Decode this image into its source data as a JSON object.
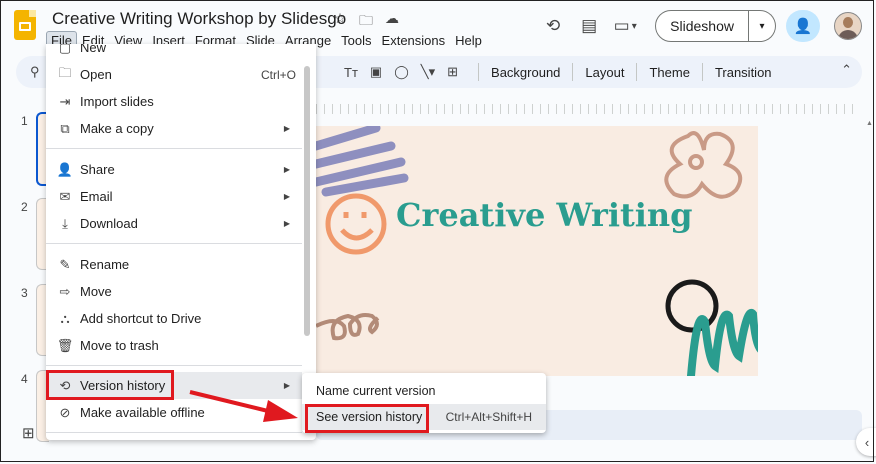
{
  "app": {
    "title": "Creative Writing Workshop by Slidesgo",
    "menus": [
      "File",
      "Edit",
      "View",
      "Insert",
      "Format",
      "Slide",
      "Arrange",
      "Tools",
      "Extensions",
      "Help"
    ],
    "active_menu": "File",
    "slideshow_label": "Slideshow"
  },
  "toolbar": {
    "buttons": [
      "Background",
      "Layout",
      "Theme",
      "Transition"
    ]
  },
  "filmstrip": {
    "slide_numbers": [
      "1",
      "2",
      "3",
      "4"
    ]
  },
  "slide": {
    "title": "Creative Writing",
    "title_color": "#2a9d8f",
    "background": "#f9ece2"
  },
  "file_menu": {
    "items": [
      {
        "label": "New",
        "icon": "new-icon",
        "submenu": true
      },
      {
        "label": "Open",
        "icon": "folder-icon",
        "shortcut": "Ctrl+O"
      },
      {
        "label": "Import slides",
        "icon": "import-icon"
      },
      {
        "label": "Make a copy",
        "icon": "copy-icon",
        "submenu": true
      },
      {
        "label": "Share",
        "icon": "person-add-icon",
        "submenu": true
      },
      {
        "label": "Email",
        "icon": "mail-icon",
        "submenu": true
      },
      {
        "label": "Download",
        "icon": "download-icon",
        "submenu": true
      },
      {
        "label": "Rename",
        "icon": "pencil-icon"
      },
      {
        "label": "Move",
        "icon": "move-folder-icon"
      },
      {
        "label": "Add shortcut to Drive",
        "icon": "drive-shortcut-icon"
      },
      {
        "label": "Move to trash",
        "icon": "trash-icon"
      },
      {
        "label": "Version history",
        "icon": "history-icon",
        "submenu": true
      },
      {
        "label": "Make available offline",
        "icon": "offline-icon"
      }
    ]
  },
  "version_submenu": {
    "items": [
      {
        "label": "Name current version",
        "shortcut": ""
      },
      {
        "label": "See version history",
        "shortcut": "Ctrl+Alt+Shift+H"
      }
    ]
  },
  "annotation": {
    "color": "#e0191f"
  }
}
